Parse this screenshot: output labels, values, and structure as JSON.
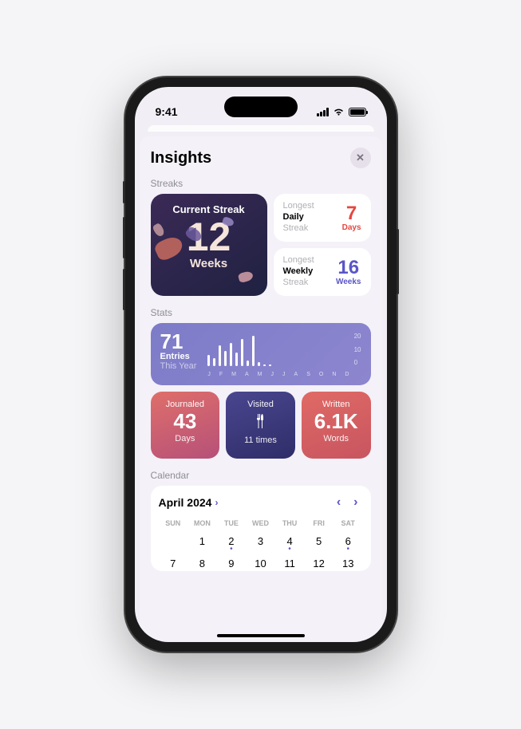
{
  "status": {
    "time": "9:41"
  },
  "header": {
    "title": "Insights",
    "close": "✕"
  },
  "sections": {
    "streaks": "Streaks",
    "stats": "Stats",
    "calendar": "Calendar"
  },
  "streaks": {
    "current": {
      "title": "Current Streak",
      "value": "12",
      "unit": "Weeks"
    },
    "daily": {
      "l1": "Longest",
      "l2": "Daily",
      "l3": "Streak",
      "value": "7",
      "unit": "Days"
    },
    "weekly": {
      "l1": "Longest",
      "l2": "Weekly",
      "l3": "Streak",
      "value": "16",
      "unit": "Weeks"
    }
  },
  "stats": {
    "entries": {
      "value": "71",
      "label1": "Entries",
      "label2": "This Year"
    },
    "yaxis": {
      "top": "20",
      "mid": "10",
      "bot": "0"
    },
    "journaled": {
      "title": "Journaled",
      "value": "43",
      "unit": "Days"
    },
    "visited": {
      "title": "Visited",
      "value": "11 times"
    },
    "written": {
      "title": "Written",
      "value": "6.1K",
      "unit": "Words"
    }
  },
  "calendar": {
    "month": "April 2024",
    "days": [
      "SUN",
      "MON",
      "TUE",
      "WED",
      "THU",
      "FRI",
      "SAT"
    ],
    "row1": [
      "",
      "1",
      "2",
      "3",
      "4",
      "5",
      "6"
    ],
    "row2": [
      "7",
      "8",
      "9",
      "10",
      "11",
      "12",
      "13"
    ]
  },
  "chart_data": {
    "type": "bar",
    "title": "Entries This Year",
    "ylim": [
      0,
      20
    ],
    "categories": [
      "J",
      "F",
      "M",
      "A",
      "M",
      "J",
      "J",
      "A",
      "S",
      "O",
      "N",
      "D"
    ],
    "values": [
      6,
      4,
      11,
      8,
      12,
      7,
      14,
      3,
      16,
      2,
      1,
      1
    ]
  }
}
